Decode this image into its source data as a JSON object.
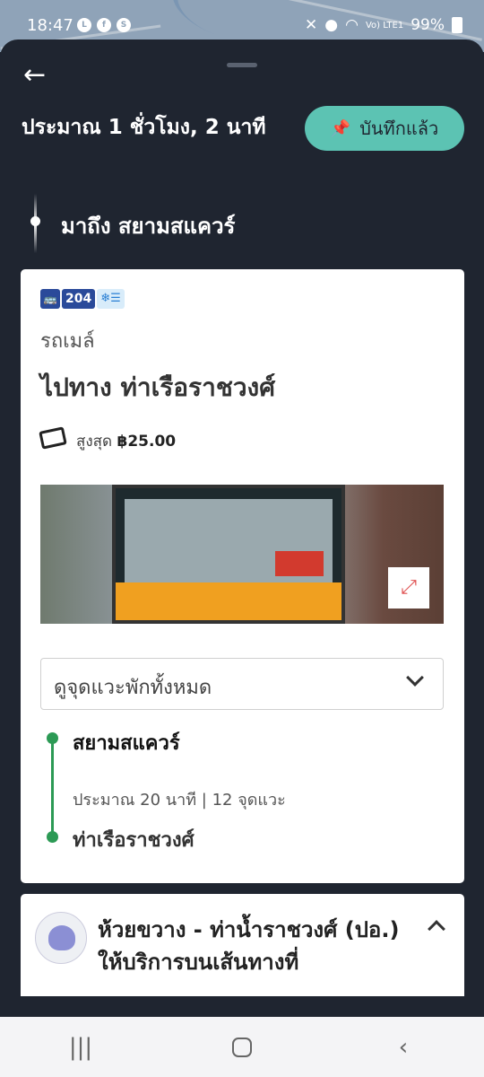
{
  "status_bar": {
    "time": "18:47",
    "battery": "99%",
    "app_icons": [
      "line-icon",
      "facebook-icon",
      "shop-icon"
    ],
    "signal_text": "Vo) LTE1"
  },
  "header": {
    "back_icon": "arrow-left-icon",
    "duration": "ประมาณ 1 ชั่วโมง, 2 นาที",
    "saved_label": "บันทึกแล้ว",
    "saved_icon": "pin-icon"
  },
  "arrival": {
    "label": "มาถึง สยามสแควร์"
  },
  "route_card": {
    "route_number": "204",
    "bus_icon": "bus-icon",
    "ac_label": "❄☰",
    "mode": "รถเมล์",
    "direction": "ไปทาง ท่าเรือราชวงศ์",
    "fare_label": "สูงสุด",
    "fare_amount": "฿25.00",
    "stops_dropdown": "ดูจุดแวะพักทั้งหมด",
    "from_stop": "สยามสแควร์",
    "meta": "ประมาณ 20 นาที  |  12 จุดแวะ",
    "to_stop": "ท่าเรือราชวงศ์"
  },
  "info_card": {
    "title": "ห้วยขวาง - ท่าน้ำราชวงศ์ (ปอ.) ให้บริการบนเส้นทางที่"
  },
  "colors": {
    "sheet_bg": "#1f2530",
    "accent_teal": "#5cc3b3",
    "route_blue": "#2a4a9a",
    "timeline_green": "#2c9a55"
  }
}
